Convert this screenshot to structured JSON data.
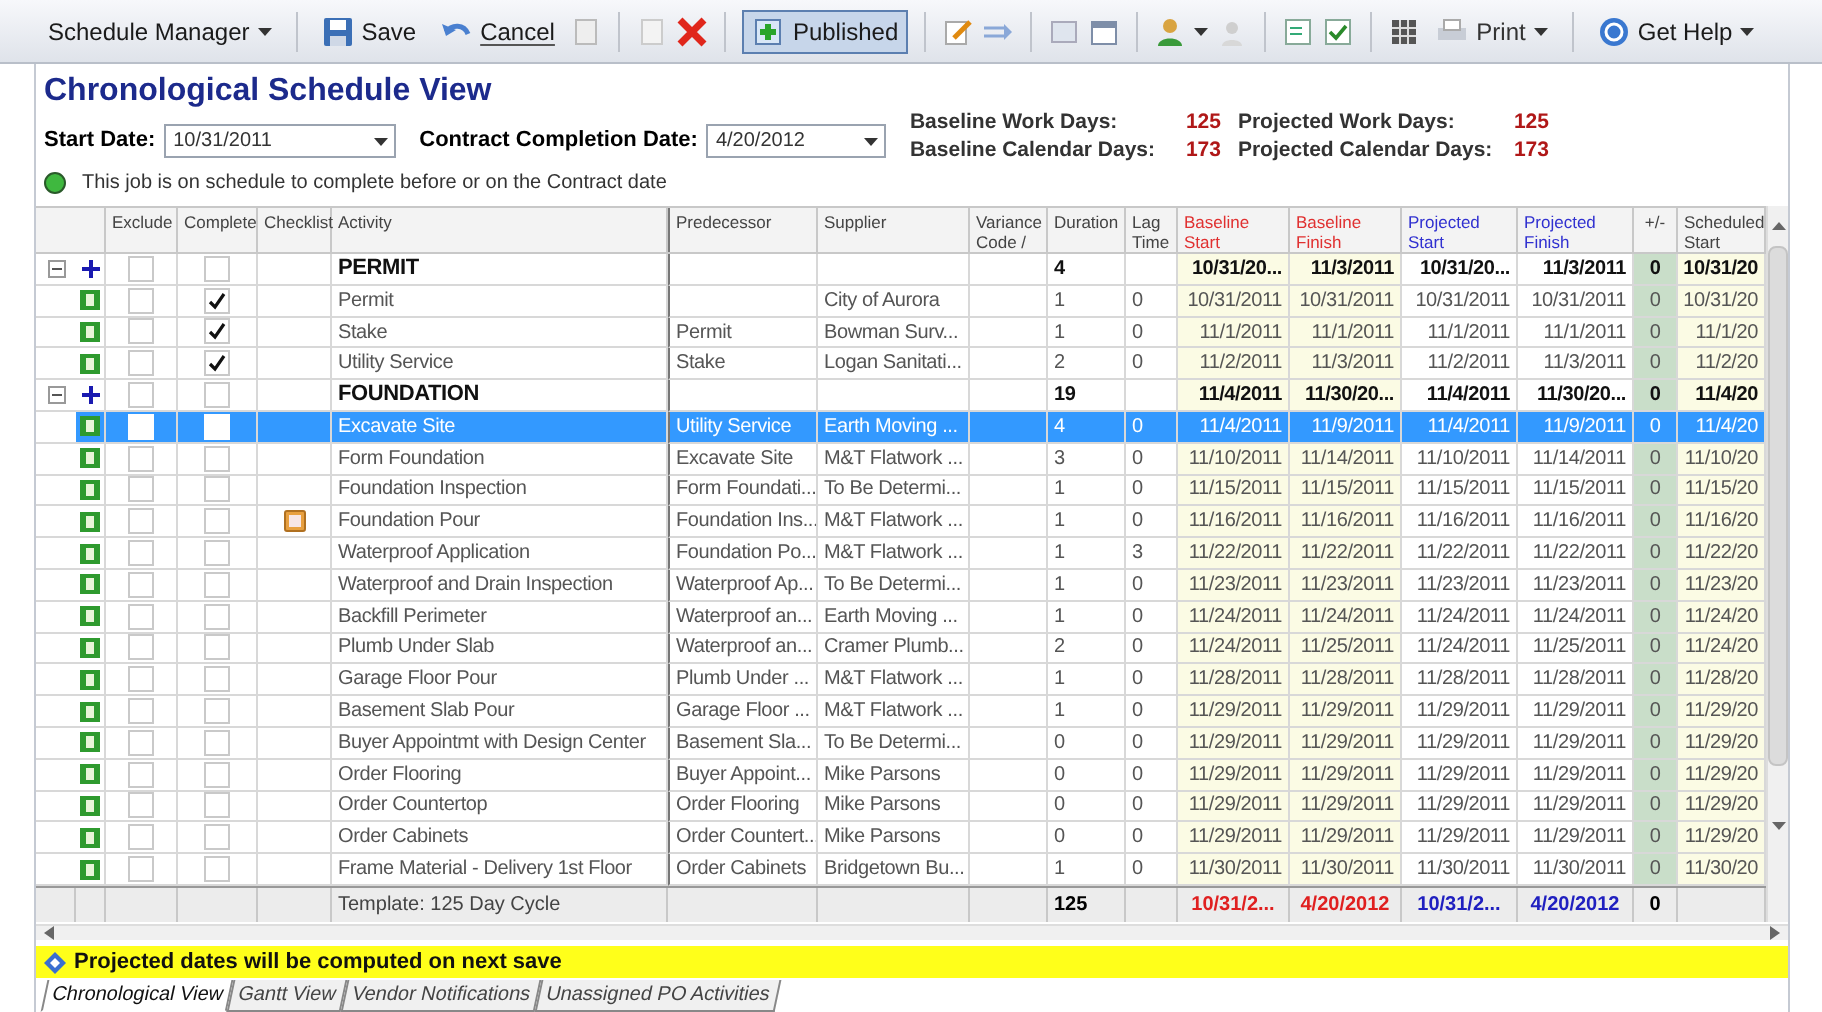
{
  "toolbar": {
    "menu": "Schedule Manager",
    "save": "Save",
    "cancel": "Cancel",
    "published": {
      "label": "Published",
      "pressed": true
    },
    "print": "Print",
    "help": "Get Help"
  },
  "title": "Chronological Schedule View",
  "start_date": {
    "label": "Start Date:",
    "value": "10/31/2011"
  },
  "completion_date": {
    "label": "Contract Completion Date:",
    "value": "4/20/2012"
  },
  "stats": [
    {
      "label": "Baseline Work Days:",
      "value": "125"
    },
    {
      "label": "Projected Work Days:",
      "value": "125"
    },
    {
      "label": "Baseline Calendar Days:",
      "value": "173"
    },
    {
      "label": "Projected Calendar Days:",
      "value": "173"
    }
  ],
  "status": {
    "on_schedule": true,
    "text": "This job is on schedule to complete before or on the Contract date"
  },
  "columns": [
    {
      "label": "Exclude"
    },
    {
      "label": "Complete"
    },
    {
      "label": "Checklist"
    },
    {
      "label": "Activity"
    },
    {
      "label": "Predecessor"
    },
    {
      "label": "Supplier"
    },
    {
      "label": "Variance Code /"
    },
    {
      "label": "Duration"
    },
    {
      "label": "Lag Time"
    },
    {
      "label": "Baseline Start",
      "color": "#e03030"
    },
    {
      "label": "Baseline Finish",
      "color": "#e03030"
    },
    {
      "label": "Projected Start",
      "color": "#3030d0"
    },
    {
      "label": "Projected Finish",
      "color": "#3030d0"
    },
    {
      "label": "+/-"
    },
    {
      "label": "Scheduled Start"
    }
  ],
  "rows": [
    {
      "kind": "group",
      "selected": false,
      "exclude": false,
      "complete": false,
      "checklist": false,
      "activity": "PERMIT",
      "predecessor": "",
      "supplier": "",
      "duration": "4",
      "lag": "",
      "bstart": "10/31/20...",
      "bfinish": "11/3/2011",
      "pstart": "10/31/20...",
      "pfinish": "11/3/2011",
      "diff": "0",
      "sstart": "10/31/20"
    },
    {
      "kind": "task",
      "selected": false,
      "exclude": false,
      "complete": true,
      "checklist": false,
      "activity": "Permit",
      "predecessor": "",
      "supplier": "City of Aurora",
      "duration": "1",
      "lag": "0",
      "bstart": "10/31/2011",
      "bfinish": "10/31/2011",
      "pstart": "10/31/2011",
      "pfinish": "10/31/2011",
      "diff": "0",
      "sstart": "10/31/20"
    },
    {
      "kind": "task",
      "selected": false,
      "exclude": false,
      "complete": true,
      "checklist": false,
      "activity": "Stake",
      "predecessor": "Permit",
      "supplier": "Bowman Surv...",
      "duration": "1",
      "lag": "0",
      "bstart": "11/1/2011",
      "bfinish": "11/1/2011",
      "pstart": "11/1/2011",
      "pfinish": "11/1/2011",
      "diff": "0",
      "sstart": "11/1/20"
    },
    {
      "kind": "task",
      "selected": false,
      "exclude": false,
      "complete": true,
      "checklist": false,
      "activity": "Utility Service",
      "predecessor": "Stake",
      "supplier": "Logan Sanitati...",
      "duration": "2",
      "lag": "0",
      "bstart": "11/2/2011",
      "bfinish": "11/3/2011",
      "pstart": "11/2/2011",
      "pfinish": "11/3/2011",
      "diff": "0",
      "sstart": "11/2/20"
    },
    {
      "kind": "group",
      "selected": false,
      "exclude": false,
      "complete": false,
      "checklist": false,
      "activity": "FOUNDATION",
      "predecessor": "",
      "supplier": "",
      "duration": "19",
      "lag": "",
      "bstart": "11/4/2011",
      "bfinish": "11/30/20...",
      "pstart": "11/4/2011",
      "pfinish": "11/30/20...",
      "diff": "0",
      "sstart": "11/4/20"
    },
    {
      "kind": "task",
      "selected": true,
      "exclude": false,
      "complete": false,
      "checklist": false,
      "activity": "Excavate Site",
      "predecessor": "Utility Service",
      "supplier": "Earth Moving ...",
      "duration": "4",
      "lag": "0",
      "bstart": "11/4/2011",
      "bfinish": "11/9/2011",
      "pstart": "11/4/2011",
      "pfinish": "11/9/2011",
      "diff": "0",
      "sstart": "11/4/20"
    },
    {
      "kind": "task",
      "selected": false,
      "exclude": false,
      "complete": false,
      "checklist": false,
      "activity": "Form Foundation",
      "predecessor": "Excavate Site",
      "supplier": "M&T Flatwork ...",
      "duration": "3",
      "lag": "0",
      "bstart": "11/10/2011",
      "bfinish": "11/14/2011",
      "pstart": "11/10/2011",
      "pfinish": "11/14/2011",
      "diff": "0",
      "sstart": "11/10/20"
    },
    {
      "kind": "task",
      "selected": false,
      "exclude": false,
      "complete": false,
      "checklist": false,
      "activity": "Foundation Inspection",
      "predecessor": "Form Foundati...",
      "supplier": "To Be Determi...",
      "duration": "1",
      "lag": "0",
      "bstart": "11/15/2011",
      "bfinish": "11/15/2011",
      "pstart": "11/15/2011",
      "pfinish": "11/15/2011",
      "diff": "0",
      "sstart": "11/15/20"
    },
    {
      "kind": "task",
      "selected": false,
      "exclude": false,
      "complete": false,
      "checklist": true,
      "activity": "Foundation Pour",
      "predecessor": "Foundation Ins...",
      "supplier": "M&T Flatwork ...",
      "duration": "1",
      "lag": "0",
      "bstart": "11/16/2011",
      "bfinish": "11/16/2011",
      "pstart": "11/16/2011",
      "pfinish": "11/16/2011",
      "diff": "0",
      "sstart": "11/16/20"
    },
    {
      "kind": "task",
      "selected": false,
      "exclude": false,
      "complete": false,
      "checklist": false,
      "activity": "Waterproof Application",
      "predecessor": "Foundation Po...",
      "supplier": "M&T Flatwork ...",
      "duration": "1",
      "lag": "3",
      "bstart": "11/22/2011",
      "bfinish": "11/22/2011",
      "pstart": "11/22/2011",
      "pfinish": "11/22/2011",
      "diff": "0",
      "sstart": "11/22/20"
    },
    {
      "kind": "task",
      "selected": false,
      "exclude": false,
      "complete": false,
      "checklist": false,
      "activity": "Waterproof and Drain Inspection",
      "predecessor": "Waterproof Ap...",
      "supplier": "To Be Determi...",
      "duration": "1",
      "lag": "0",
      "bstart": "11/23/2011",
      "bfinish": "11/23/2011",
      "pstart": "11/23/2011",
      "pfinish": "11/23/2011",
      "diff": "0",
      "sstart": "11/23/20"
    },
    {
      "kind": "task",
      "selected": false,
      "exclude": false,
      "complete": false,
      "checklist": false,
      "activity": "Backfill Perimeter",
      "predecessor": "Waterproof an...",
      "supplier": "Earth Moving ...",
      "duration": "1",
      "lag": "0",
      "bstart": "11/24/2011",
      "bfinish": "11/24/2011",
      "pstart": "11/24/2011",
      "pfinish": "11/24/2011",
      "diff": "0",
      "sstart": "11/24/20"
    },
    {
      "kind": "task",
      "selected": false,
      "exclude": false,
      "complete": false,
      "checklist": false,
      "activity": "Plumb Under Slab",
      "predecessor": "Waterproof an...",
      "supplier": "Cramer Plumb...",
      "duration": "2",
      "lag": "0",
      "bstart": "11/24/2011",
      "bfinish": "11/25/2011",
      "pstart": "11/24/2011",
      "pfinish": "11/25/2011",
      "diff": "0",
      "sstart": "11/24/20"
    },
    {
      "kind": "task",
      "selected": false,
      "exclude": false,
      "complete": false,
      "checklist": false,
      "activity": "Garage Floor Pour",
      "predecessor": "Plumb Under ...",
      "supplier": "M&T Flatwork ...",
      "duration": "1",
      "lag": "0",
      "bstart": "11/28/2011",
      "bfinish": "11/28/2011",
      "pstart": "11/28/2011",
      "pfinish": "11/28/2011",
      "diff": "0",
      "sstart": "11/28/20"
    },
    {
      "kind": "task",
      "selected": false,
      "exclude": false,
      "complete": false,
      "checklist": false,
      "activity": "Basement Slab Pour",
      "predecessor": "Garage Floor ...",
      "supplier": "M&T Flatwork ...",
      "duration": "1",
      "lag": "0",
      "bstart": "11/29/2011",
      "bfinish": "11/29/2011",
      "pstart": "11/29/2011",
      "pfinish": "11/29/2011",
      "diff": "0",
      "sstart": "11/29/20"
    },
    {
      "kind": "task",
      "selected": false,
      "exclude": false,
      "complete": false,
      "checklist": false,
      "activity": "Buyer Appointmt with Design Center",
      "predecessor": "Basement Sla...",
      "supplier": "To Be Determi...",
      "duration": "0",
      "lag": "0",
      "bstart": "11/29/2011",
      "bfinish": "11/29/2011",
      "pstart": "11/29/2011",
      "pfinish": "11/29/2011",
      "diff": "0",
      "sstart": "11/29/20"
    },
    {
      "kind": "task",
      "selected": false,
      "exclude": false,
      "complete": false,
      "checklist": false,
      "activity": "Order Flooring",
      "predecessor": "Buyer Appoint...",
      "supplier": "Mike Parsons",
      "duration": "0",
      "lag": "0",
      "bstart": "11/29/2011",
      "bfinish": "11/29/2011",
      "pstart": "11/29/2011",
      "pfinish": "11/29/2011",
      "diff": "0",
      "sstart": "11/29/20"
    },
    {
      "kind": "task",
      "selected": false,
      "exclude": false,
      "complete": false,
      "checklist": false,
      "activity": "Order Countertop",
      "predecessor": "Order Flooring",
      "supplier": "Mike Parsons",
      "duration": "0",
      "lag": "0",
      "bstart": "11/29/2011",
      "bfinish": "11/29/2011",
      "pstart": "11/29/2011",
      "pfinish": "11/29/2011",
      "diff": "0",
      "sstart": "11/29/20"
    },
    {
      "kind": "task",
      "selected": false,
      "exclude": false,
      "complete": false,
      "checklist": false,
      "activity": "Order Cabinets",
      "predecessor": "Order Countert...",
      "supplier": "Mike Parsons",
      "duration": "0",
      "lag": "0",
      "bstart": "11/29/2011",
      "bfinish": "11/29/2011",
      "pstart": "11/29/2011",
      "pfinish": "11/29/2011",
      "diff": "0",
      "sstart": "11/29/20"
    },
    {
      "kind": "task",
      "selected": false,
      "exclude": false,
      "complete": false,
      "checklist": false,
      "activity": "Frame Material - Delivery 1st Floor",
      "predecessor": "Order Cabinets",
      "supplier": "Bridgetown Bu...",
      "duration": "1",
      "lag": "0",
      "bstart": "11/30/2011",
      "bfinish": "11/30/2011",
      "pstart": "11/30/2011",
      "pfinish": "11/30/2011",
      "diff": "0",
      "sstart": "11/30/20"
    }
  ],
  "footer": {
    "activity": "Template: 125 Day Cycle",
    "duration": "125",
    "bstart": "10/31/2...",
    "bfinish": "4/20/2012",
    "pstart": "10/31/2...",
    "pfinish": "4/20/2012",
    "diff": "0"
  },
  "notice": "Projected dates will be computed on next save",
  "tabs": [
    {
      "label": "Chronological View",
      "selected": true
    },
    {
      "label": "Gantt View",
      "selected": false
    },
    {
      "label": "Vendor Notifications",
      "selected": false
    },
    {
      "label": "Unassigned PO Activities",
      "selected": false
    }
  ]
}
